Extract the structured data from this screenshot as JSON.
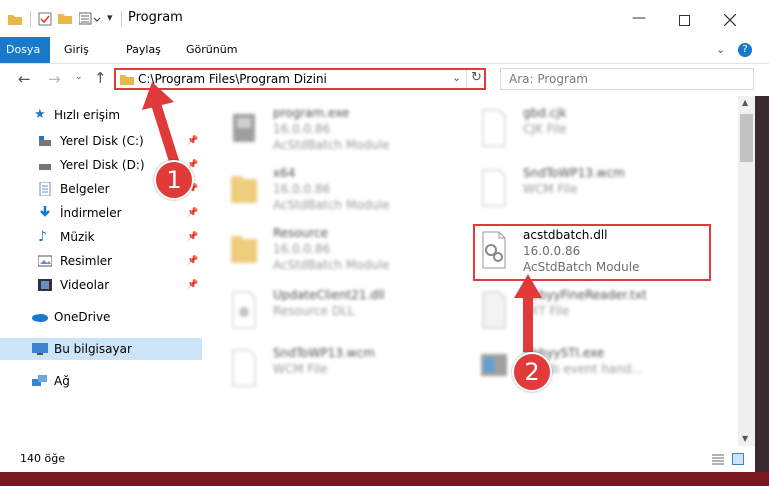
{
  "window": {
    "title": "Program"
  },
  "ribbon": {
    "tabs": [
      "Dosya",
      "Giriş",
      "Paylaş",
      "Görünüm"
    ]
  },
  "address": {
    "path": "C:\\Program Files\\Program Dizini"
  },
  "search": {
    "placeholder": "Ara: Program"
  },
  "sidebar": {
    "quick_access": "Hızlı erişim",
    "items": [
      {
        "label": "Yerel Disk (C:)",
        "pinned": true
      },
      {
        "label": "Yerel Disk (D:)",
        "pinned": true
      },
      {
        "label": "Belgeler",
        "pinned": true
      },
      {
        "label": "İndirmeler",
        "pinned": true
      },
      {
        "label": "Müzik",
        "pinned": true
      },
      {
        "label": "Resimler",
        "pinned": true
      },
      {
        "label": "Videolar",
        "pinned": true
      }
    ],
    "onedrive": "OneDrive",
    "this_pc": "Bu bilgisayar",
    "network": "Ağ"
  },
  "files": {
    "left": [
      {
        "name": "program.exe",
        "line2": "16.0.0.86",
        "line3": "AcStdBatch Module"
      },
      {
        "name": "x64",
        "line2": "16.0.0.86",
        "line3": "AcStdBatch Module"
      },
      {
        "name": "Resource",
        "line2": "16.0.0.86",
        "line3": "AcStdBatch Module"
      },
      {
        "name": "UpdateClient21.dll",
        "line2": "Resource DLL",
        "line3": ""
      },
      {
        "name": "SndToWP13.wcm",
        "line2": "WCM File",
        "line3": ""
      }
    ],
    "right": [
      {
        "name": "gbd.cjk",
        "line2": "CJK File",
        "line3": ""
      },
      {
        "name": "SndToWP13.wcm",
        "line2": "WCM File",
        "line3": ""
      },
      {
        "name": "acstdbatch.dll",
        "line2": "16.0.0.86",
        "line3": "AcStdBatch Module"
      },
      {
        "name": "AbbyyFineReader.txt",
        "line2": "TXT File",
        "line3": ""
      },
      {
        "name": "AbbyySTI.exe",
        "line2": "STI cb event hand...",
        "line3": ""
      }
    ]
  },
  "status": {
    "count": "140 öğe"
  },
  "annotations": {
    "step1": "1",
    "step2": "2"
  },
  "colors": {
    "accent": "#1979ca",
    "highlight": "#e03a3a"
  }
}
